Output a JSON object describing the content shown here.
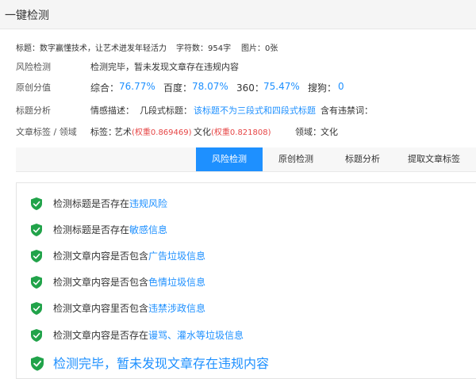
{
  "header": {
    "title": "一键检测"
  },
  "meta": {
    "title_label": "标题：",
    "title_value": "数字赢懂技术，让艺术迸发年轻活力",
    "char_count_label": "字符数：",
    "char_count_value": "954字",
    "image_label": "图片：",
    "image_value": "0张"
  },
  "risk": {
    "label": "风险检测",
    "value": "检测完毕，暂未发现文章存在违规内容"
  },
  "originality": {
    "label": "原创分值",
    "items": [
      {
        "name": "综合：",
        "value": "76.77%"
      },
      {
        "name": "百度：",
        "value": "78.07%"
      },
      {
        "name": "360：",
        "value": "75.47%"
      },
      {
        "name": "搜狗：",
        "value": "0"
      }
    ]
  },
  "title_analysis": {
    "label": "标题分析",
    "sentiment_label": "情感描述：",
    "sentiment_value": "",
    "segments_label": "几段式标题：",
    "segments_value": "该标题不为三段式和四段式标题",
    "banned_label": "含有违禁词：",
    "banned_value": ""
  },
  "tags": {
    "label": "文章标签 / 领域",
    "tags_label": "标签：",
    "tag1": "艺术",
    "tag1_weight": "(权重0.869469)",
    "tag2": "文化",
    "tag2_weight": "(权重0.821808)",
    "domain_label": "领域：",
    "domain_value": "文化"
  },
  "tabs": [
    {
      "label": "风险检测",
      "active": true
    },
    {
      "label": "原创检测",
      "active": false
    },
    {
      "label": "标题分析",
      "active": false
    },
    {
      "label": "提取文章标签",
      "active": false
    }
  ],
  "checks": [
    {
      "prefix": "检测标题是否存在",
      "highlight": "违规风险"
    },
    {
      "prefix": "检测标题是否存在",
      "highlight": "敏感信息"
    },
    {
      "prefix": "检测文章内容是否包含",
      "highlight": "广告垃圾信息"
    },
    {
      "prefix": "检测文章内容是否包含",
      "highlight": "色情垃圾信息"
    },
    {
      "prefix": "检测文章内容里否包含",
      "highlight": "违禁涉政信息"
    },
    {
      "prefix": "检测文章内容是否存在",
      "highlight": "谩骂、灌水等垃圾信息"
    }
  ],
  "final_result": "检测完毕，暂未发现文章存在违规内容",
  "colors": {
    "accent": "#1e90ff",
    "shield": "#21a34a",
    "weight": "#e64545"
  },
  "icons": {
    "check": "shield-check-icon"
  }
}
